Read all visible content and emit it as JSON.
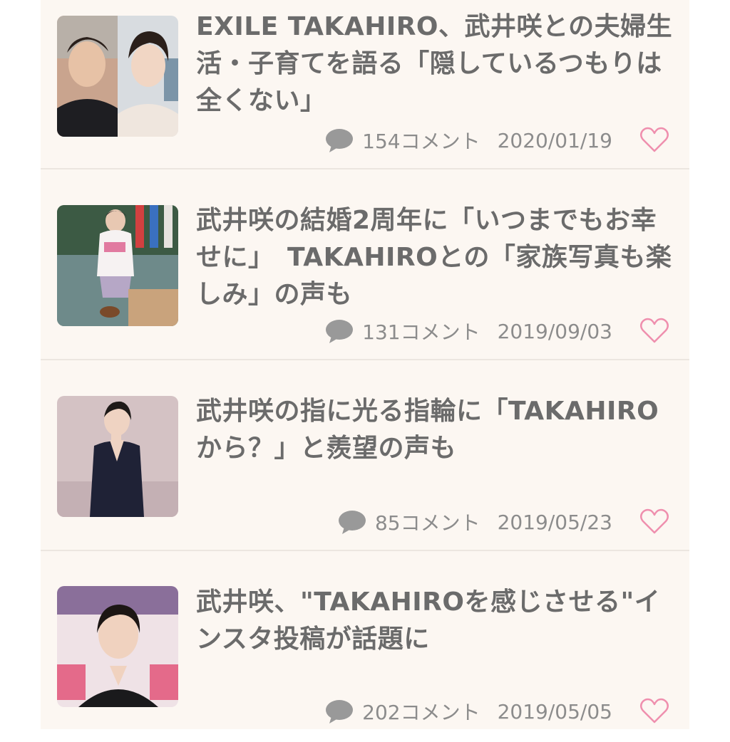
{
  "articles": [
    {
      "title": "EXILE TAKAHIRO、武井咲との夫婦生活・子育てを語る「隠しているつもりは全くない」",
      "comments": "154コメント",
      "date": "2020/01/19",
      "thumbnail": "two-person-photo"
    },
    {
      "title": "武井咲の結婚2周年に「いつまでもお幸せに」　TAKAHIROとの「家族写真も楽しみ」の声も",
      "comments": "131コメント",
      "date": "2019/09/03",
      "thumbnail": "garden-photo"
    },
    {
      "title": "武井咲の指に光る指輪に「TAKAHIROから？」と羨望の声も",
      "comments": "85コメント",
      "date": "2019/05/23",
      "thumbnail": "portrait-photo"
    },
    {
      "title": "武井咲、\"TAKAHIROを感じさせる\"インスタ投稿が話題に",
      "comments": "202コメント",
      "date": "2019/05/05",
      "thumbnail": "event-photo"
    }
  ],
  "icons": {
    "comment": "speech-bubble-icon",
    "favorite": "heart-outline-icon"
  },
  "colors": {
    "title": "#6b6b6b",
    "meta": "#8c8c8c",
    "heart": "#ef8fae",
    "background": "#fcf7f2",
    "separator": "#ece6e0"
  }
}
